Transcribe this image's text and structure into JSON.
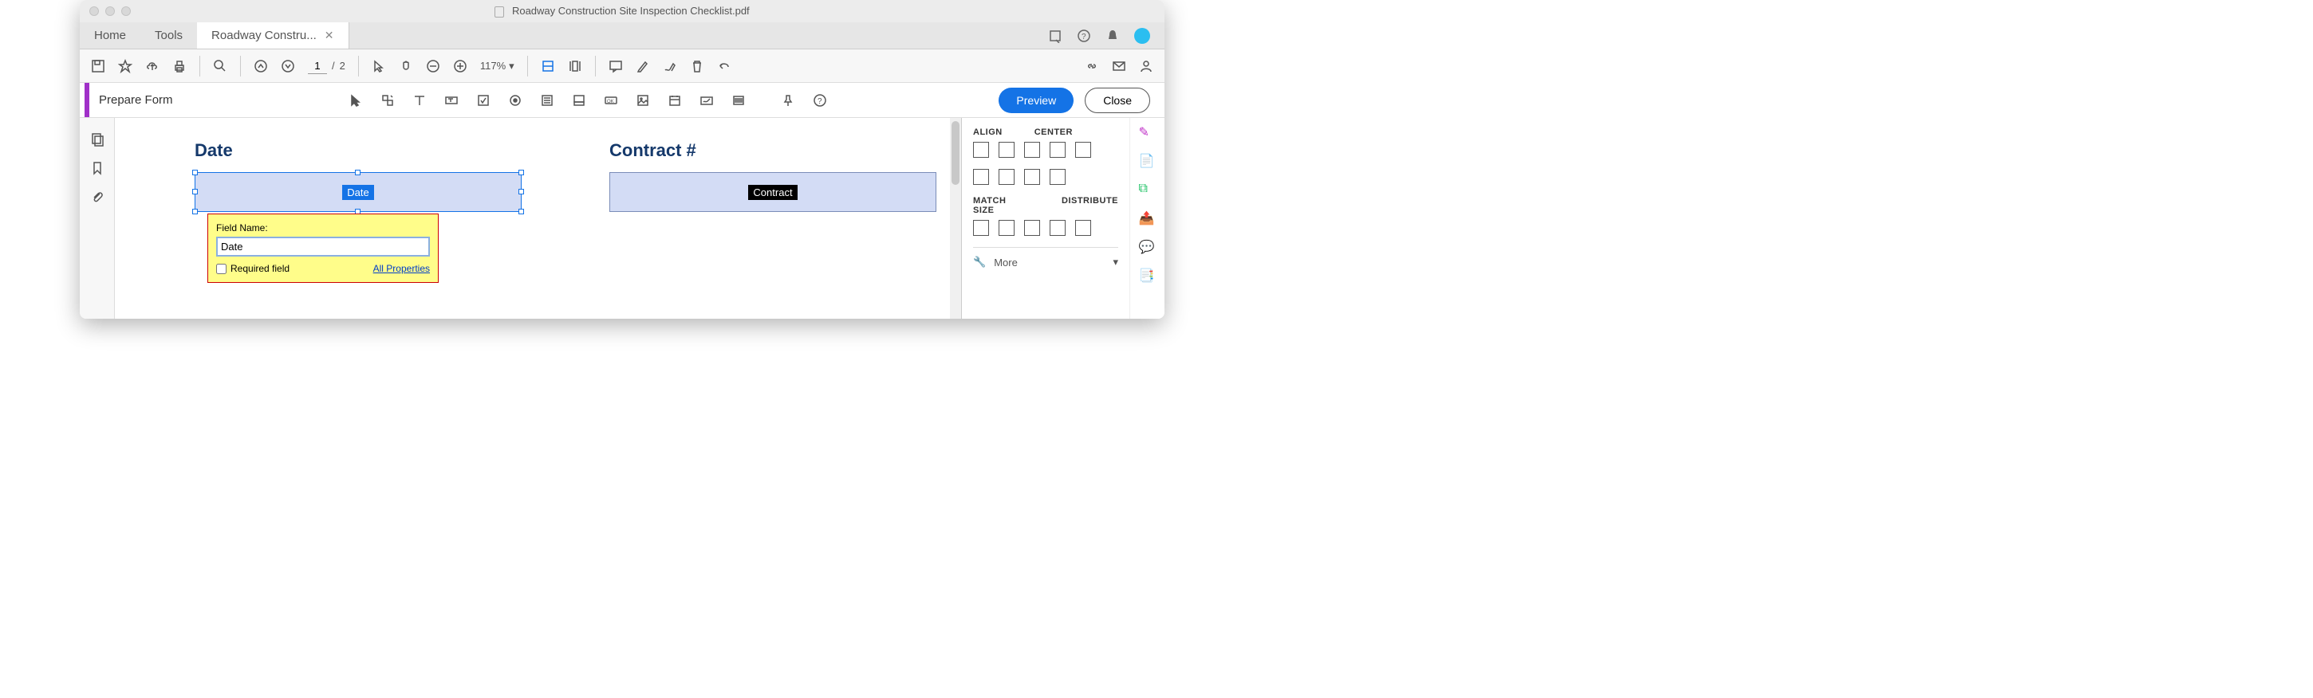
{
  "window": {
    "title": "Roadway Construction Site Inspection Checklist.pdf"
  },
  "tabs": {
    "home": "Home",
    "tools": "Tools",
    "doc": "Roadway Constru..."
  },
  "toolbar": {
    "page_current": "1",
    "page_total": "2",
    "zoom": "117%"
  },
  "formbar": {
    "label": "Prepare Form",
    "preview": "Preview",
    "close": "Close"
  },
  "doc": {
    "date_heading": "Date",
    "date_field_label": "Date",
    "contract_heading": "Contract #",
    "contract_field_label": "Contract"
  },
  "popup": {
    "fieldname_label": "Field Name:",
    "fieldname_value": "Date",
    "required_label": "Required field",
    "all_properties": "All Properties"
  },
  "panel": {
    "align": "ALIGN",
    "center": "CENTER",
    "match": "MATCH SIZE",
    "distribute": "DISTRIBUTE",
    "more": "More"
  }
}
